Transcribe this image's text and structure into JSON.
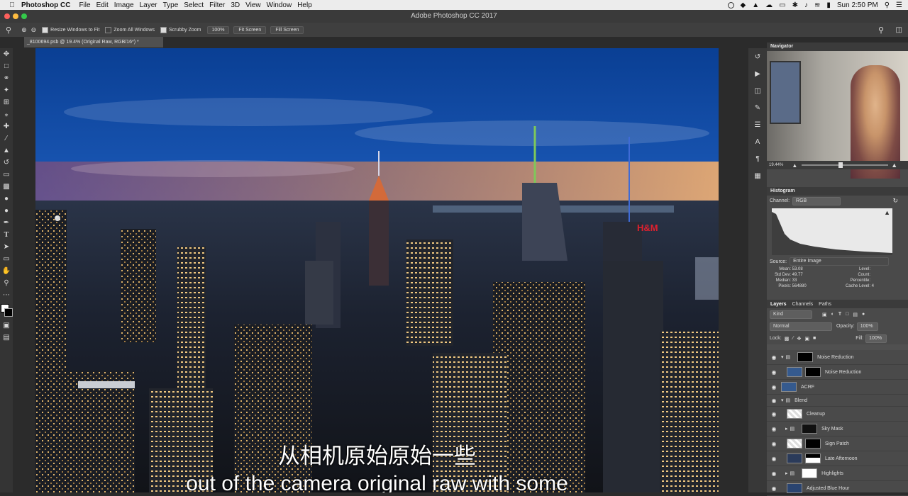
{
  "menubar": {
    "app_name": "Photoshop CC",
    "items": [
      "File",
      "Edit",
      "Image",
      "Layer",
      "Type",
      "Select",
      "Filter",
      "3D",
      "View",
      "Window",
      "Help"
    ],
    "clock": "Sun 2:50 PM"
  },
  "window": {
    "title": "Adobe Photoshop CC 2017"
  },
  "options_bar": {
    "resize_windows_label": "Resize Windows to Fit",
    "zoom_all_label": "Zoom All Windows",
    "scrubby_zoom_label": "Scrubby Zoom",
    "zoom_value": "100%",
    "fit_screen_label": "Fit Screen",
    "fill_screen_label": "Fill Screen"
  },
  "document": {
    "tab_label": "_8100694.psb @ 19.4% (Original Raw, RGB/16*) *"
  },
  "subtitles": {
    "chinese": "从相机原始原始一些",
    "english": "out of the camera original raw with some"
  },
  "navigator": {
    "title": "Navigator",
    "zoom": "19.44%"
  },
  "histogram": {
    "title": "Histogram",
    "channel_label": "Channel:",
    "channel_value": "RGB",
    "source_label": "Source:",
    "source_value": "Entire Image",
    "stats_left": [
      {
        "label": "Mean:",
        "value": "53.08"
      },
      {
        "label": "Std Dev:",
        "value": "49.77"
      },
      {
        "label": "Median:",
        "value": "33"
      },
      {
        "label": "Pixels:",
        "value": "564880"
      }
    ],
    "stats_right": [
      {
        "label": "Level:",
        "value": ""
      },
      {
        "label": "Count:",
        "value": ""
      },
      {
        "label": "Percentile:",
        "value": ""
      },
      {
        "label": "Cache Level:",
        "value": "4"
      }
    ]
  },
  "layers_panel": {
    "tabs": [
      "Layers",
      "Channels",
      "Paths"
    ],
    "kind_filter": "Kind",
    "blend_mode": "Normal",
    "opacity_label": "Opacity:",
    "opacity_value": "100%",
    "lock_label": "Lock:",
    "fill_label": "Fill:",
    "fill_value": "100%",
    "layers": [
      {
        "name": "Noise Reduction"
      },
      {
        "name": "Noise Reduction"
      },
      {
        "name": "ACRF"
      },
      {
        "name": "Blend"
      },
      {
        "name": "Cleanup"
      },
      {
        "name": "Sky Mask"
      },
      {
        "name": "Sign Patch"
      },
      {
        "name": "Late Afternoon"
      },
      {
        "name": "Highlights"
      },
      {
        "name": "Adjusted Blue Hour"
      }
    ]
  }
}
